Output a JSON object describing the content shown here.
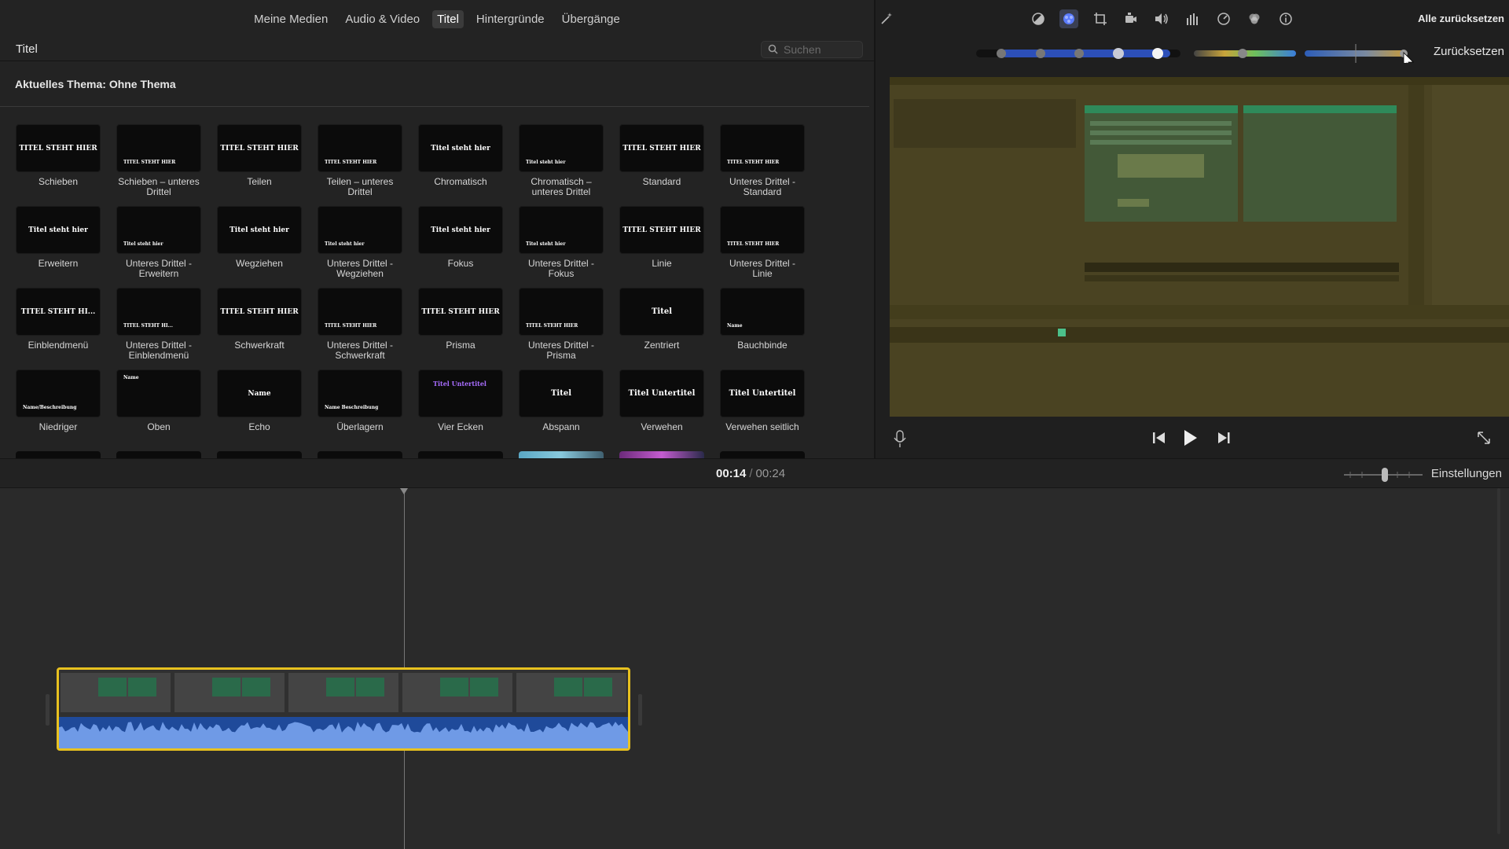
{
  "browser": {
    "tabs": [
      {
        "label": "Meine Medien",
        "active": false
      },
      {
        "label": "Audio & Video",
        "active": false
      },
      {
        "label": "Titel",
        "active": true
      },
      {
        "label": "Hintergründe",
        "active": false
      },
      {
        "label": "Übergänge",
        "active": false
      }
    ],
    "section_title": "Titel",
    "search_placeholder": "Suchen",
    "theme_label": "Aktuelles Thema: Ohne Thema",
    "titles": [
      {
        "label": "Schieben",
        "thumb_text": "TITEL STEHT HIER"
      },
      {
        "label": "Schieben – unteres Drittel",
        "thumb_text": "TITEL STEHT HIER"
      },
      {
        "label": "Teilen",
        "thumb_text": "TITEL STEHT HIER"
      },
      {
        "label": "Teilen – unteres Drittel",
        "thumb_text": "TITEL STEHT HIER"
      },
      {
        "label": "Chromatisch",
        "thumb_text": "Titel steht hier"
      },
      {
        "label": "Chromatisch – unteres Drittel",
        "thumb_text": "Titel steht hier"
      },
      {
        "label": "Standard",
        "thumb_text": "TITEL STEHT HIER"
      },
      {
        "label": "Unteres Drittel - Standard",
        "thumb_text": "TITEL STEHT HIER"
      },
      {
        "label": "Erweitern",
        "thumb_text": "Titel steht hier"
      },
      {
        "label": "Unteres Drittel - Erweitern",
        "thumb_text": "Titel steht hier"
      },
      {
        "label": "Wegziehen",
        "thumb_text": "Titel steht hier"
      },
      {
        "label": "Unteres Drittel - Wegziehen",
        "thumb_text": "Titel steht hier"
      },
      {
        "label": "Fokus",
        "thumb_text": "Titel steht hier"
      },
      {
        "label": "Unteres Drittel - Fokus",
        "thumb_text": "Titel steht hier"
      },
      {
        "label": "Linie",
        "thumb_text": "TITEL STEHT HIER"
      },
      {
        "label": "Unteres Drittel - Linie",
        "thumb_text": "TITEL STEHT HIER"
      },
      {
        "label": "Einblendmenü",
        "thumb_text": "TITEL STEHT HI..."
      },
      {
        "label": "Unteres Drittel - Einblendmenü",
        "thumb_text": "TITEL STEHT HI..."
      },
      {
        "label": "Schwerkraft",
        "thumb_text": "TITEL STEHT HIER"
      },
      {
        "label": "Unteres Drittel - Schwerkraft",
        "thumb_text": "TITEL STEHT HIER"
      },
      {
        "label": "Prisma",
        "thumb_text": "TITEL STEHT HIER"
      },
      {
        "label": "Unteres Drittel - Prisma",
        "thumb_text": "TITEL STEHT HIER"
      },
      {
        "label": "Zentriert",
        "thumb_text": "Titel"
      },
      {
        "label": "Bauchbinde",
        "thumb_text": "Name"
      },
      {
        "label": "Niedriger",
        "thumb_text": "Name/Beschreibung"
      },
      {
        "label": "Oben",
        "thumb_text": "Name"
      },
      {
        "label": "Echo",
        "thumb_text": "Name"
      },
      {
        "label": "Überlagern",
        "thumb_text": "Name Beschreibung"
      },
      {
        "label": "Vier Ecken",
        "thumb_text": "Titel Untertitel"
      },
      {
        "label": "Abspann",
        "thumb_text": "Titel"
      },
      {
        "label": "Verwehen",
        "thumb_text": "Titel Untertitel"
      },
      {
        "label": "Verwehen seitlich",
        "thumb_text": "Titel Untertitel"
      }
    ]
  },
  "viewer": {
    "tools": [
      "magic-wand-icon",
      "color-balance-icon",
      "color-correction-icon",
      "crop-icon",
      "stabilization-icon",
      "volume-icon",
      "equalizer-icon",
      "speed-icon",
      "noise-reduction-icon",
      "info-icon"
    ],
    "reset_all_label": "Alle zurücksetzen",
    "reset_label": "Zurücksetzen"
  },
  "timeline": {
    "current_time": "00:14",
    "separator": "/",
    "total_time": "00:24",
    "settings_label": "Einstellungen"
  }
}
